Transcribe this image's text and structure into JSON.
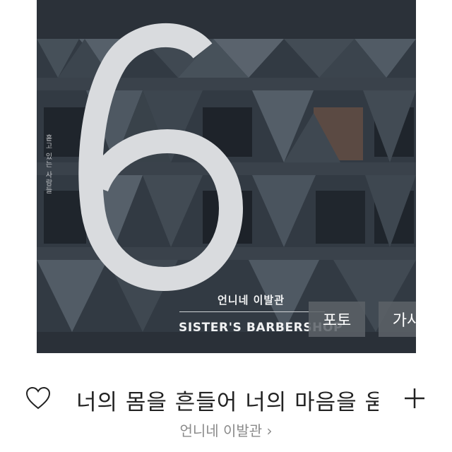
{
  "cover": {
    "number": "6",
    "vertical_text": "흩고 있는 사람들",
    "artist": "언니네 이발관",
    "album": "SISTER'S BARBERSHOP"
  },
  "overlay": {
    "photo_label": "포토",
    "lyrics_label": "가사"
  },
  "track": {
    "title": "너의 몸을 흔들어 너의 마음을 움직여",
    "artist_link": "언니네 이발관 ›"
  },
  "icons": {
    "like": "heart-icon",
    "add": "plus-icon",
    "more": "chevron-right-icon"
  },
  "colors": {
    "cover_bg": "#333b44",
    "overlay_button": "#5c6268",
    "title": "#222222",
    "subtitle": "#8a8a8a"
  }
}
